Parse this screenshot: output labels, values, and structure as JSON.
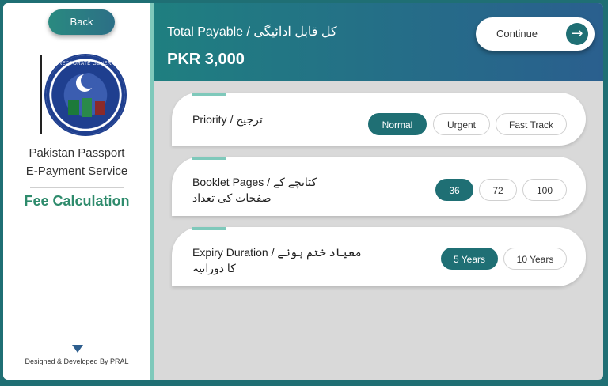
{
  "sidebar": {
    "back_label": "Back",
    "logo_ring_text": "DIRECTORATE GENERAL",
    "app_title_line1": "Pakistan Passport",
    "app_title_line2": "E-Payment Service",
    "section_title": "Fee Calculation",
    "credit": "Designed & Developed By PRAL"
  },
  "header": {
    "total_label": "Total Payable / کل قابل ادائیگی",
    "amount": "PKR 3,000",
    "continue_label": "Continue"
  },
  "cards": {
    "priority": {
      "label": "Priority / ترجیح",
      "options": [
        "Normal",
        "Urgent",
        "Fast Track"
      ],
      "selected": "Normal"
    },
    "pages": {
      "label_line1": "Booklet Pages / کتابچے کے",
      "label_line2": "صفحات کی تعداد",
      "options": [
        "36",
        "72",
        "100"
      ],
      "selected": "36"
    },
    "expiry": {
      "label_line1": "Expiry Duration / معیاد ختم ہونے",
      "label_line2": "کا دورانیہ",
      "options": [
        "5 Years",
        "10 Years"
      ],
      "selected": "5 Years"
    }
  },
  "colors": {
    "accent": "#1f6f74",
    "highlight": "#2e8b6c",
    "sidebar_border": "#7fc9bb"
  }
}
